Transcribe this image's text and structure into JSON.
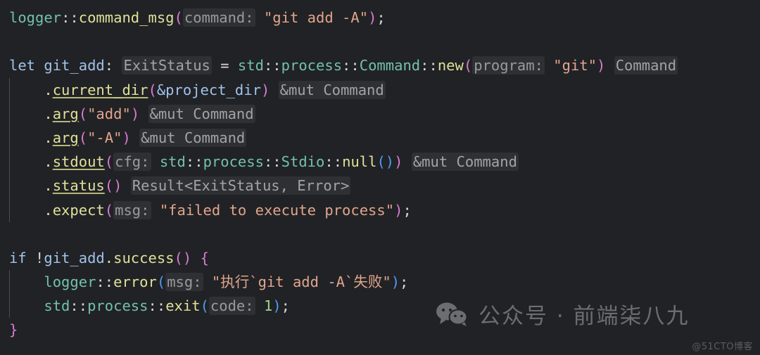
{
  "editor": {
    "language": "rust",
    "background_color": "#212225",
    "font_size_px": 20.5,
    "indent_guide_color": "#4b4d51",
    "colors": {
      "keyword": "#a0c2ea",
      "variable": "#a0c2ea",
      "path_type": "#71c2a8",
      "function": "#e0e09a",
      "punctuation": "#d9d9d6",
      "paren_pink": "#d77ad4",
      "paren_blue": "#4e9bf0",
      "string": "#e0a58d",
      "number": "#9fd58a",
      "inlay_hint_text": "#9a9a9a",
      "inlay_hint_background": "#2e3033"
    },
    "lines": [
      {
        "n": 1,
        "text": "logger::command_msg(command: \"git add -A\");",
        "tokens": [
          {
            "t": "logger",
            "c": "path"
          },
          {
            "t": "::",
            "c": "punc"
          },
          {
            "t": "command_msg",
            "c": "fn"
          },
          {
            "t": "(",
            "c": "paren"
          },
          {
            "t": "command:",
            "c": "hint"
          },
          {
            "t": " ",
            "c": "plain"
          },
          {
            "t": "\"git add -A\"",
            "c": "str"
          },
          {
            "t": ")",
            "c": "paren"
          },
          {
            "t": ";",
            "c": "punc"
          }
        ]
      },
      {
        "n": 2,
        "text": "",
        "tokens": []
      },
      {
        "n": 3,
        "text": "let git_add: ExitStatus = std::process::Command::new(program: \"git\") Command",
        "tokens": [
          {
            "t": "let",
            "c": "kw"
          },
          {
            "t": " ",
            "c": "plain"
          },
          {
            "t": "git_add",
            "c": "var"
          },
          {
            "t": ":",
            "c": "punc"
          },
          {
            "t": " ",
            "c": "plain"
          },
          {
            "t": "ExitStatus",
            "c": "hint-t"
          },
          {
            "t": " = ",
            "c": "punc"
          },
          {
            "t": "std",
            "c": "path"
          },
          {
            "t": "::",
            "c": "punc"
          },
          {
            "t": "process",
            "c": "path"
          },
          {
            "t": "::",
            "c": "punc"
          },
          {
            "t": "Command",
            "c": "path"
          },
          {
            "t": "::",
            "c": "punc"
          },
          {
            "t": "new",
            "c": "fn"
          },
          {
            "t": "(",
            "c": "paren"
          },
          {
            "t": "program:",
            "c": "hint"
          },
          {
            "t": " ",
            "c": "plain"
          },
          {
            "t": "\"git\"",
            "c": "str"
          },
          {
            "t": ")",
            "c": "paren"
          },
          {
            "t": " ",
            "c": "plain"
          },
          {
            "t": "Command",
            "c": "hint-t"
          }
        ]
      },
      {
        "n": 4,
        "indent": 1,
        "text": ".current_dir(&project_dir) &mut Command",
        "tokens": [
          {
            "t": ".",
            "c": "fn"
          },
          {
            "t": "current_dir",
            "c": "fnu"
          },
          {
            "t": "(",
            "c": "paren"
          },
          {
            "t": "&project_dir",
            "c": "var"
          },
          {
            "t": ")",
            "c": "paren"
          },
          {
            "t": " ",
            "c": "plain"
          },
          {
            "t": "&mut Command",
            "c": "hint-t"
          }
        ]
      },
      {
        "n": 5,
        "indent": 1,
        "text": ".arg(\"add\") &mut Command",
        "tokens": [
          {
            "t": ".",
            "c": "fn"
          },
          {
            "t": "arg",
            "c": "fnu"
          },
          {
            "t": "(",
            "c": "paren"
          },
          {
            "t": "\"add\"",
            "c": "str"
          },
          {
            "t": ")",
            "c": "paren"
          },
          {
            "t": " ",
            "c": "plain"
          },
          {
            "t": "&mut Command",
            "c": "hint-t"
          }
        ]
      },
      {
        "n": 6,
        "indent": 1,
        "text": ".arg(\"-A\") &mut Command",
        "tokens": [
          {
            "t": ".",
            "c": "fn"
          },
          {
            "t": "arg",
            "c": "fnu"
          },
          {
            "t": "(",
            "c": "paren"
          },
          {
            "t": "\"-A\"",
            "c": "str"
          },
          {
            "t": ")",
            "c": "paren"
          },
          {
            "t": " ",
            "c": "plain"
          },
          {
            "t": "&mut Command",
            "c": "hint-t"
          }
        ]
      },
      {
        "n": 7,
        "indent": 1,
        "text": ".stdout(cfg: std::process::Stdio::null()) &mut Command",
        "tokens": [
          {
            "t": ".",
            "c": "fn"
          },
          {
            "t": "stdout",
            "c": "fnu"
          },
          {
            "t": "(",
            "c": "paren"
          },
          {
            "t": "cfg:",
            "c": "hint"
          },
          {
            "t": " ",
            "c": "plain"
          },
          {
            "t": "std",
            "c": "path"
          },
          {
            "t": "::",
            "c": "punc"
          },
          {
            "t": "process",
            "c": "path"
          },
          {
            "t": "::",
            "c": "punc"
          },
          {
            "t": "Stdio",
            "c": "path"
          },
          {
            "t": "::",
            "c": "punc"
          },
          {
            "t": "null",
            "c": "fn"
          },
          {
            "t": "()",
            "c": "paren2"
          },
          {
            "t": ")",
            "c": "paren"
          },
          {
            "t": " ",
            "c": "plain"
          },
          {
            "t": "&mut Command",
            "c": "hint-t"
          }
        ]
      },
      {
        "n": 8,
        "indent": 1,
        "text": ".status() Result<ExitStatus, Error>",
        "tokens": [
          {
            "t": ".",
            "c": "fn"
          },
          {
            "t": "status",
            "c": "fnu"
          },
          {
            "t": "()",
            "c": "paren"
          },
          {
            "t": " ",
            "c": "plain"
          },
          {
            "t": "Result<ExitStatus, Error>",
            "c": "hint-t"
          }
        ]
      },
      {
        "n": 9,
        "indent": 1,
        "text": ".expect(msg: \"failed to execute process\");",
        "tokens": [
          {
            "t": ".",
            "c": "fn"
          },
          {
            "t": "expect",
            "c": "fn"
          },
          {
            "t": "(",
            "c": "paren"
          },
          {
            "t": "msg:",
            "c": "hint"
          },
          {
            "t": " ",
            "c": "plain"
          },
          {
            "t": "\"failed to execute process\"",
            "c": "str"
          },
          {
            "t": ")",
            "c": "paren"
          },
          {
            "t": ";",
            "c": "punc"
          }
        ]
      },
      {
        "n": 10,
        "text": "",
        "tokens": []
      },
      {
        "n": 11,
        "text": "if !git_add.success() {",
        "tokens": [
          {
            "t": "if",
            "c": "kw"
          },
          {
            "t": " ",
            "c": "plain"
          },
          {
            "t": "!",
            "c": "bang"
          },
          {
            "t": "git_add",
            "c": "var"
          },
          {
            "t": ".",
            "c": "fn"
          },
          {
            "t": "success",
            "c": "fn"
          },
          {
            "t": "()",
            "c": "paren"
          },
          {
            "t": " ",
            "c": "plain"
          },
          {
            "t": "{",
            "c": "brace"
          }
        ]
      },
      {
        "n": 12,
        "indent": 1,
        "text": "logger::error(msg: \"执行`git add -A`失败\");",
        "tokens": [
          {
            "t": "logger",
            "c": "path"
          },
          {
            "t": "::",
            "c": "punc"
          },
          {
            "t": "error",
            "c": "fn"
          },
          {
            "t": "(",
            "c": "paren2"
          },
          {
            "t": "msg:",
            "c": "hint"
          },
          {
            "t": " ",
            "c": "plain"
          },
          {
            "t": "\"执行`git add -A`失败\"",
            "c": "str"
          },
          {
            "t": ")",
            "c": "paren2"
          },
          {
            "t": ";",
            "c": "punc"
          }
        ]
      },
      {
        "n": 13,
        "indent": 1,
        "text": "std::process::exit(code: 1);",
        "tokens": [
          {
            "t": "std",
            "c": "path"
          },
          {
            "t": "::",
            "c": "punc"
          },
          {
            "t": "process",
            "c": "path"
          },
          {
            "t": "::",
            "c": "punc"
          },
          {
            "t": "exit",
            "c": "fn"
          },
          {
            "t": "(",
            "c": "paren2"
          },
          {
            "t": "code:",
            "c": "hint"
          },
          {
            "t": " ",
            "c": "plain"
          },
          {
            "t": "1",
            "c": "num"
          },
          {
            "t": ")",
            "c": "paren2"
          },
          {
            "t": ";",
            "c": "punc"
          }
        ]
      },
      {
        "n": 14,
        "text": "}",
        "tokens": [
          {
            "t": "}",
            "c": "brace"
          }
        ]
      }
    ]
  },
  "watermark": {
    "wechat_label": "公众号 · 前端柒八九",
    "wechat_icon": "wechat-icon",
    "corner_label": "@51CTO博客"
  }
}
